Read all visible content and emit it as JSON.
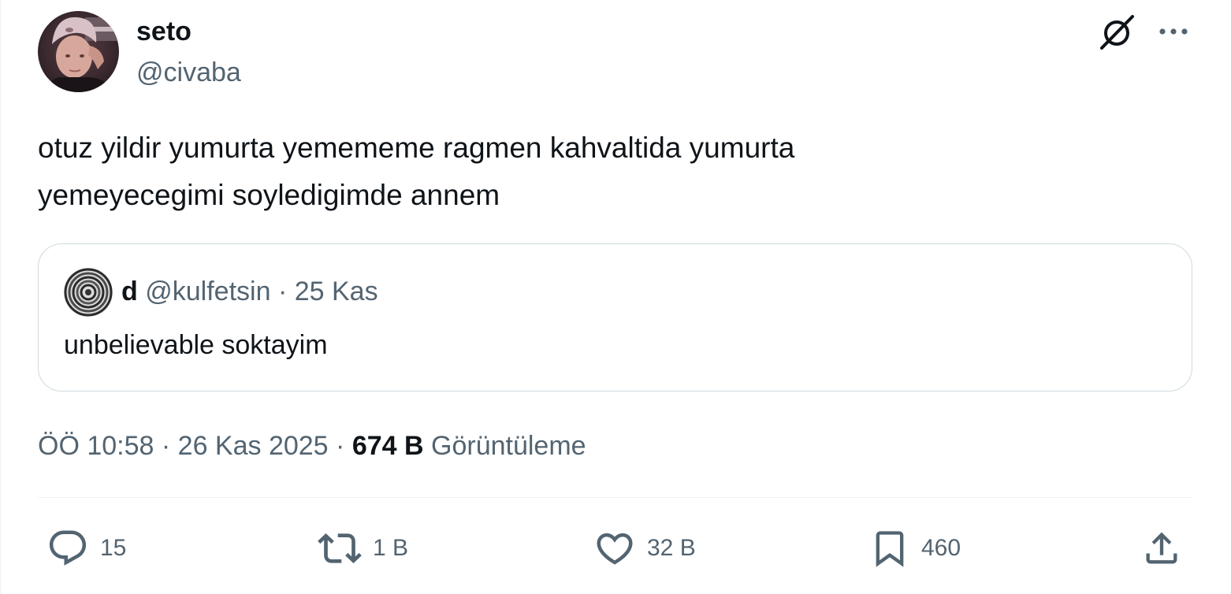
{
  "author": {
    "name": "seto",
    "handle": "@civaba"
  },
  "tweet": {
    "text": "otuz yildir yumurta yemememe ragmen kahvaltida yumurta\nyemeyecegimi soyledigimde annem"
  },
  "quote": {
    "name": "d",
    "handle": "@kulfetsin",
    "separator": "·",
    "date": "25 Kas",
    "text": "unbelievable soktayim"
  },
  "meta": {
    "time": "ÖÖ 10:58",
    "separator": "·",
    "date": "26 Kas 2025",
    "views_count": "674 B",
    "views_label": "Görüntüleme"
  },
  "actions": {
    "replies": "15",
    "reposts": "1 B",
    "likes": "32 B",
    "bookmarks": "460"
  },
  "icons": {
    "grok": "grok-icon",
    "more": "more-icon",
    "reply": "reply-icon",
    "repost": "repost-icon",
    "like": "heart-icon",
    "bookmark": "bookmark-icon",
    "share": "share-icon"
  },
  "colors": {
    "text_primary": "#0f1419",
    "text_secondary": "#536471",
    "border": "#cfd9de",
    "divider": "#eff3f4"
  }
}
